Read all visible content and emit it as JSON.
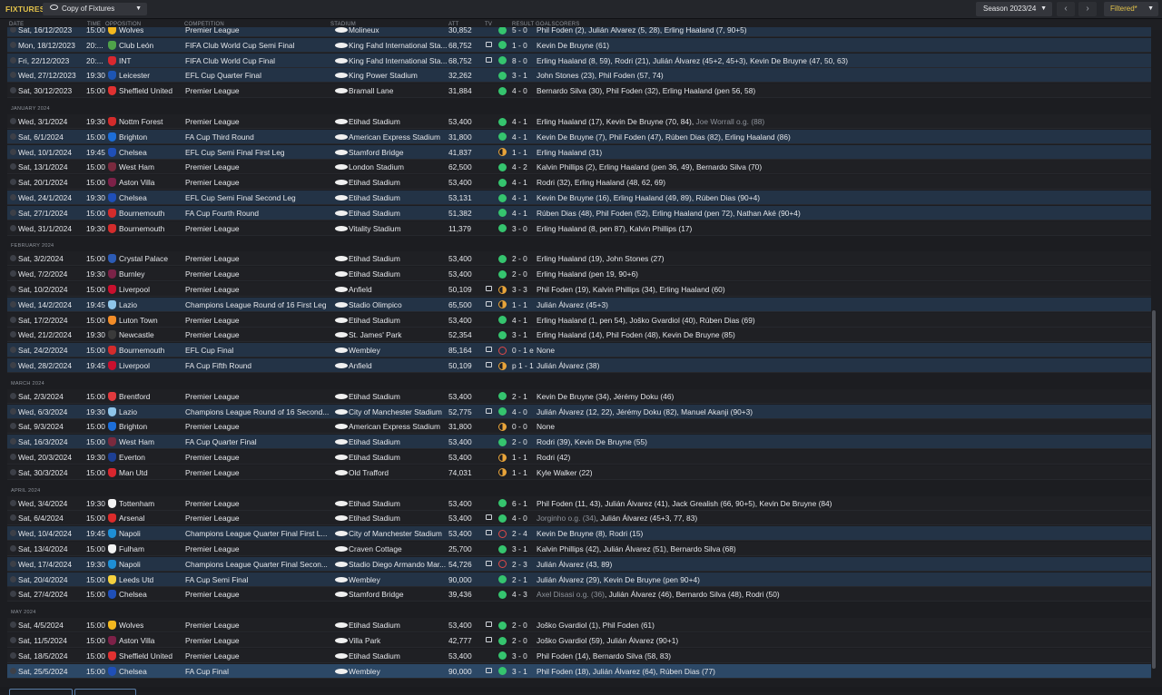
{
  "header": {
    "title": "FIXTURES",
    "view_label": "Copy of Fixtures",
    "season_label": "Season 2023/24",
    "filter_label": "Filtered*"
  },
  "columns": {
    "date": "DATE",
    "time": "TIME",
    "opposition": "OPPOSITION",
    "competition": "COMPETITION",
    "stadium": "STADIUM",
    "att": "ATT",
    "tv": "TV",
    "result": "RESULT",
    "goalscorers": "GOALSCORERS"
  },
  "colors": {
    "win": "#35c46e",
    "draw": "#e8a43a",
    "loss": "#e04848",
    "accent": "#e2c24a"
  },
  "items": [
    {
      "t": "m",
      "date": "Sat, 16/12/2023",
      "time": "15:00",
      "opp": "Wolves",
      "comp": "Premier League",
      "stad": "Molineux",
      "att": "30,852",
      "tv": false,
      "st": "win",
      "res": "5 - 0",
      "goals": "Phil Foden (2), Julián Álvarez (5, 28), Erling Haaland (7, 90+5)",
      "og": "",
      "c": "#f3b81f",
      "bg": "alt"
    },
    {
      "t": "m",
      "date": "Mon, 18/12/2023",
      "time": "20:...",
      "opp": "Club León",
      "comp": "FIFA Club World Cup Semi Final",
      "stad": "King Fahd International Sta...",
      "att": "68,752",
      "tv": true,
      "st": "win",
      "res": "1 - 0",
      "goals": "Kevin De Bruyne (61)",
      "og": "",
      "c": "#4fa34a",
      "bg": "alt"
    },
    {
      "t": "m",
      "date": "Fri, 22/12/2023",
      "time": "20:...",
      "opp": "INT",
      "comp": "FIFA Club World Cup Final",
      "stad": "King Fahd International Sta...",
      "att": "68,752",
      "tv": true,
      "st": "win",
      "res": "8 - 0",
      "goals": "Erling Haaland (8, 59), Rodri (21), Julián Álvarez (45+2, 45+3), Kevin De Bruyne (47, 50, 63)",
      "og": "",
      "c": "#d9282f",
      "bg": "alt"
    },
    {
      "t": "m",
      "date": "Wed, 27/12/2023",
      "time": "19:30",
      "opp": "Leicester",
      "comp": "EFL Cup Quarter Final",
      "stad": "King Power Stadium",
      "att": "32,262",
      "tv": false,
      "st": "win",
      "res": "3 - 1",
      "goals": "John Stones (23), Phil Foden (57, 74)",
      "og": "",
      "c": "#1d55b3",
      "bg": "alt"
    },
    {
      "t": "m",
      "date": "Sat, 30/12/2023",
      "time": "15:00",
      "opp": "Sheffield United",
      "comp": "Premier League",
      "stad": "Bramall Lane",
      "att": "31,884",
      "tv": false,
      "st": "win",
      "res": "4 - 0",
      "goals": "Bernardo Silva (30), Phil Foden (32), Erling Haaland (pen 56, 58)",
      "og": "",
      "c": "#e03131",
      "bg": "plain"
    },
    {
      "t": "h",
      "label": "JANUARY 2024"
    },
    {
      "t": "m",
      "date": "Wed, 3/1/2024",
      "time": "19:30",
      "opp": "Nottm Forest",
      "comp": "Premier League",
      "stad": "Etihad Stadium",
      "att": "53,400",
      "tv": false,
      "st": "win",
      "res": "4 - 1",
      "goals": "Erling Haaland (17), Kevin De Bruyne (70, 84), ",
      "og": "Joe Worrall o.g. (88)",
      "c": "#d22b2b",
      "bg": "plain"
    },
    {
      "t": "m",
      "date": "Sat, 6/1/2024",
      "time": "15:00",
      "opp": "Brighton",
      "comp": "FA Cup Third Round",
      "stad": "American Express Stadium",
      "att": "31,800",
      "tv": false,
      "st": "win",
      "res": "4 - 1",
      "goals": "Kevin De Bruyne (7), Phil Foden (47), Rúben Dias (82), Erling Haaland (86)",
      "og": "",
      "c": "#1d6ed8",
      "bg": "alt"
    },
    {
      "t": "m",
      "date": "Wed, 10/1/2024",
      "time": "19:45",
      "opp": "Chelsea",
      "comp": "EFL Cup Semi Final First Leg",
      "stad": "Stamford Bridge",
      "att": "41,837",
      "tv": false,
      "st": "draw",
      "res": "1 - 1",
      "goals": "Erling Haaland (31)",
      "og": "",
      "c": "#1f4fb8",
      "bg": "alt"
    },
    {
      "t": "m",
      "date": "Sat, 13/1/2024",
      "time": "15:00",
      "opp": "West Ham",
      "comp": "Premier League",
      "stad": "London Stadium",
      "att": "62,500",
      "tv": false,
      "st": "win",
      "res": "4 - 2",
      "goals": "Kalvin Phillips (2), Erling Haaland (pen 36, 49), Bernardo Silva (70)",
      "og": "",
      "c": "#7a2a3e",
      "bg": "plain"
    },
    {
      "t": "m",
      "date": "Sat, 20/1/2024",
      "time": "15:00",
      "opp": "Aston Villa",
      "comp": "Premier League",
      "stad": "Etihad Stadium",
      "att": "53,400",
      "tv": false,
      "st": "win",
      "res": "4 - 1",
      "goals": "Rodri (32), Erling Haaland (48, 62, 69)",
      "og": "",
      "c": "#7d2148",
      "bg": "plain"
    },
    {
      "t": "m",
      "date": "Wed, 24/1/2024",
      "time": "19:30",
      "opp": "Chelsea",
      "comp": "EFL Cup Semi Final Second Leg",
      "stad": "Etihad Stadium",
      "att": "53,131",
      "tv": false,
      "st": "win",
      "res": "4 - 1",
      "goals": "Kevin De Bruyne (16), Erling Haaland (49, 89), Rúben Dias (90+4)",
      "og": "",
      "c": "#1f4fb8",
      "bg": "alt"
    },
    {
      "t": "m",
      "date": "Sat, 27/1/2024",
      "time": "15:00",
      "opp": "Bournemouth",
      "comp": "FA Cup Fourth Round",
      "stad": "Etihad Stadium",
      "att": "51,382",
      "tv": false,
      "st": "win",
      "res": "4 - 1",
      "goals": "Rúben Dias (48), Phil Foden (52), Erling Haaland (pen 72), Nathan Aké (90+4)",
      "og": "",
      "c": "#d32c2c",
      "bg": "alt"
    },
    {
      "t": "m",
      "date": "Wed, 31/1/2024",
      "time": "19:30",
      "opp": "Bournemouth",
      "comp": "Premier League",
      "stad": "Vitality Stadium",
      "att": "11,379",
      "tv": false,
      "st": "win",
      "res": "3 - 0",
      "goals": "Erling Haaland (8, pen 87), Kalvin Phillips (17)",
      "og": "",
      "c": "#d32c2c",
      "bg": "plain"
    },
    {
      "t": "h",
      "label": "FEBRUARY 2024"
    },
    {
      "t": "m",
      "date": "Sat, 3/2/2024",
      "time": "15:00",
      "opp": "Crystal Palace",
      "comp": "Premier League",
      "stad": "Etihad Stadium",
      "att": "53,400",
      "tv": false,
      "st": "win",
      "res": "2 - 0",
      "goals": "Erling Haaland (19), John Stones (27)",
      "og": "",
      "c": "#2c5bb5",
      "bg": "plain"
    },
    {
      "t": "m",
      "date": "Wed, 7/2/2024",
      "time": "19:30",
      "opp": "Burnley",
      "comp": "Premier League",
      "stad": "Etihad Stadium",
      "att": "53,400",
      "tv": false,
      "st": "win",
      "res": "2 - 0",
      "goals": "Erling Haaland (pen 19, 90+6)",
      "og": "",
      "c": "#7a2347",
      "bg": "plain"
    },
    {
      "t": "m",
      "date": "Sat, 10/2/2024",
      "time": "15:00",
      "opp": "Liverpool",
      "comp": "Premier League",
      "stad": "Anfield",
      "att": "50,109",
      "tv": true,
      "st": "draw",
      "res": "3 - 3",
      "goals": "Phil Foden (19), Kalvin Phillips (34), Erling Haaland (60)",
      "og": "",
      "c": "#c8102e",
      "bg": "plain"
    },
    {
      "t": "m",
      "date": "Wed, 14/2/2024",
      "time": "19:45",
      "opp": "Lazio",
      "comp": "Champions League Round of 16  First Leg",
      "stad": "Stadio Olimpico",
      "att": "65,500",
      "tv": true,
      "st": "draw",
      "res": "1 - 1",
      "goals": "Julián Álvarez (45+3)",
      "og": "",
      "c": "#8ec5ea",
      "bg": "alt"
    },
    {
      "t": "m",
      "date": "Sat, 17/2/2024",
      "time": "15:00",
      "opp": "Luton Town",
      "comp": "Premier League",
      "stad": "Etihad Stadium",
      "att": "53,400",
      "tv": false,
      "st": "win",
      "res": "4 - 1",
      "goals": "Erling Haaland (1, pen 54), Joško Gvardiol (40), Rúben Dias (69)",
      "og": "",
      "c": "#f28c28",
      "bg": "plain"
    },
    {
      "t": "m",
      "date": "Wed, 21/2/2024",
      "time": "19:30",
      "opp": "Newcastle",
      "comp": "Premier League",
      "stad": "St. James' Park",
      "att": "52,354",
      "tv": false,
      "st": "win",
      "res": "3 - 1",
      "goals": "Erling Haaland (14), Phil Foden (48), Kevin De Bruyne (85)",
      "og": "",
      "c": "#3a3a3a",
      "bg": "plain"
    },
    {
      "t": "m",
      "date": "Sat, 24/2/2024",
      "time": "15:00",
      "opp": "Bournemouth",
      "comp": "EFL Cup Final",
      "stad": "Wembley",
      "att": "85,164",
      "tv": true,
      "st": "loss",
      "res": "0 - 1 e",
      "goals": "None",
      "og": "",
      "c": "#d32c2c",
      "bg": "alt"
    },
    {
      "t": "m",
      "date": "Wed, 28/2/2024",
      "time": "19:45",
      "opp": "Liverpool",
      "comp": "FA Cup Fifth Round",
      "stad": "Anfield",
      "att": "50,109",
      "tv": true,
      "st": "draw",
      "res": "p 1 - 1",
      "goals": "Julián Álvarez (38)",
      "og": "",
      "c": "#c8102e",
      "bg": "alt"
    },
    {
      "t": "h",
      "label": "MARCH 2024"
    },
    {
      "t": "m",
      "date": "Sat, 2/3/2024",
      "time": "15:00",
      "opp": "Brentford",
      "comp": "Premier League",
      "stad": "Etihad Stadium",
      "att": "53,400",
      "tv": false,
      "st": "win",
      "res": "2 - 1",
      "goals": "Kevin De Bruyne (34), Jérémy Doku (46)",
      "og": "",
      "c": "#e03a3e",
      "bg": "plain"
    },
    {
      "t": "m",
      "date": "Wed, 6/3/2024",
      "time": "19:30",
      "opp": "Lazio",
      "comp": "Champions League Round of 16  Second...",
      "stad": "City of Manchester Stadium",
      "att": "52,775",
      "tv": true,
      "st": "win",
      "res": "4 - 0",
      "goals": "Julián Álvarez (12, 22), Jérémy Doku (82), Manuel Akanji (90+3)",
      "og": "",
      "c": "#8ec5ea",
      "bg": "alt"
    },
    {
      "t": "m",
      "date": "Sat, 9/3/2024",
      "time": "15:00",
      "opp": "Brighton",
      "comp": "Premier League",
      "stad": "American Express Stadium",
      "att": "31,800",
      "tv": false,
      "st": "draw",
      "res": "0 - 0",
      "goals": "None",
      "og": "",
      "c": "#1d6ed8",
      "bg": "plain"
    },
    {
      "t": "m",
      "date": "Sat, 16/3/2024",
      "time": "15:00",
      "opp": "West Ham",
      "comp": "FA Cup Quarter Final",
      "stad": "Etihad Stadium",
      "att": "53,400",
      "tv": false,
      "st": "win",
      "res": "2 - 0",
      "goals": "Rodri (39), Kevin De Bruyne (55)",
      "og": "",
      "c": "#7a2a3e",
      "bg": "alt"
    },
    {
      "t": "m",
      "date": "Wed, 20/3/2024",
      "time": "19:30",
      "opp": "Everton",
      "comp": "Premier League",
      "stad": "Etihad Stadium",
      "att": "53,400",
      "tv": false,
      "st": "draw",
      "res": "1 - 1",
      "goals": "Rodri (42)",
      "og": "",
      "c": "#1d3f94",
      "bg": "plain"
    },
    {
      "t": "m",
      "date": "Sat, 30/3/2024",
      "time": "15:00",
      "opp": "Man Utd",
      "comp": "Premier League",
      "stad": "Old Trafford",
      "att": "74,031",
      "tv": false,
      "st": "draw",
      "res": "1 - 1",
      "goals": "Kyle Walker (22)",
      "og": "",
      "c": "#d8262e",
      "bg": "plain"
    },
    {
      "t": "h",
      "label": "APRIL 2024"
    },
    {
      "t": "m",
      "date": "Wed, 3/4/2024",
      "time": "19:30",
      "opp": "Tottenham",
      "comp": "Premier League",
      "stad": "Etihad Stadium",
      "att": "53,400",
      "tv": false,
      "st": "win",
      "res": "6 - 1",
      "goals": "Phil Foden (11, 43), Julián Álvarez (41), Jack Grealish (66, 90+5), Kevin De Bruyne (84)",
      "og": "",
      "c": "#f2f2f2",
      "bg": "plain"
    },
    {
      "t": "m",
      "date": "Sat, 6/4/2024",
      "time": "15:00",
      "opp": "Arsenal",
      "comp": "Premier League",
      "stad": "Etihad Stadium",
      "att": "53,400",
      "tv": true,
      "st": "win",
      "res": "4 - 0",
      "goals": "",
      "og": "Jorginho o.g. (34)",
      "goals2": ", Julián Álvarez (45+3, 77, 83)",
      "c": "#db2b2b",
      "bg": "plain"
    },
    {
      "t": "m",
      "date": "Wed, 10/4/2024",
      "time": "19:45",
      "opp": "Napoli",
      "comp": "Champions League Quarter Final First L...",
      "stad": "City of Manchester Stadium",
      "att": "53,400",
      "tv": true,
      "st": "loss",
      "res": "2 - 4",
      "goals": "Kevin De Bruyne (8), Rodri (15)",
      "og": "",
      "c": "#1e8fd6",
      "bg": "alt"
    },
    {
      "t": "m",
      "date": "Sat, 13/4/2024",
      "time": "15:00",
      "opp": "Fulham",
      "comp": "Premier League",
      "stad": "Craven Cottage",
      "att": "25,700",
      "tv": false,
      "st": "win",
      "res": "3 - 1",
      "goals": "Kalvin Phillips (42), Julián Álvarez (51), Bernardo Silva (68)",
      "og": "",
      "c": "#f2f2f2",
      "bg": "plain"
    },
    {
      "t": "m",
      "date": "Wed, 17/4/2024",
      "time": "19:30",
      "opp": "Napoli",
      "comp": "Champions League Quarter Final Secon...",
      "stad": "Stadio Diego Armando Mar...",
      "att": "54,726",
      "tv": true,
      "st": "loss",
      "res": "2 - 3",
      "goals": "Julián Álvarez (43, 89)",
      "og": "",
      "c": "#1e8fd6",
      "bg": "alt"
    },
    {
      "t": "m",
      "date": "Sat, 20/4/2024",
      "time": "15:00",
      "opp": "Leeds Utd",
      "comp": "FA Cup Semi Final",
      "stad": "Wembley",
      "att": "90,000",
      "tv": false,
      "st": "win",
      "res": "2 - 1",
      "goals": "Julián Álvarez (29), Kevin De Bruyne (pen 90+4)",
      "og": "",
      "c": "#f4d03f",
      "bg": "alt"
    },
    {
      "t": "m",
      "date": "Sat, 27/4/2024",
      "time": "15:00",
      "opp": "Chelsea",
      "comp": "Premier League",
      "stad": "Stamford Bridge",
      "att": "39,436",
      "tv": false,
      "st": "win",
      "res": "4 - 3",
      "goals": "",
      "og": "Axel Disasi o.g. (36)",
      "goals2": ", Julián Álvarez (46), Bernardo Silva (48), Rodri (50)",
      "c": "#1f4fb8",
      "bg": "plain"
    },
    {
      "t": "h",
      "label": "MAY 2024"
    },
    {
      "t": "m",
      "date": "Sat, 4/5/2024",
      "time": "15:00",
      "opp": "Wolves",
      "comp": "Premier League",
      "stad": "Etihad Stadium",
      "att": "53,400",
      "tv": true,
      "st": "win",
      "res": "2 - 0",
      "goals": "Joško Gvardiol (1), Phil Foden (61)",
      "og": "",
      "c": "#f3b81f",
      "bg": "plain"
    },
    {
      "t": "m",
      "date": "Sat, 11/5/2024",
      "time": "15:00",
      "opp": "Aston Villa",
      "comp": "Premier League",
      "stad": "Villa Park",
      "att": "42,777",
      "tv": true,
      "st": "win",
      "res": "2 - 0",
      "goals": "Joško Gvardiol (59), Julián Álvarez (90+1)",
      "og": "",
      "c": "#7d2148",
      "bg": "plain"
    },
    {
      "t": "m",
      "date": "Sat, 18/5/2024",
      "time": "15:00",
      "opp": "Sheffield United",
      "comp": "Premier League",
      "stad": "Etihad Stadium",
      "att": "53,400",
      "tv": false,
      "st": "win",
      "res": "3 - 0",
      "goals": "Phil Foden (14), Bernardo Silva (58, 83)",
      "og": "",
      "c": "#e03131",
      "bg": "plain"
    },
    {
      "t": "m",
      "date": "Sat, 25/5/2024",
      "time": "15:00",
      "opp": "Chelsea",
      "comp": "FA Cup Final",
      "stad": "Wembley",
      "att": "90,000",
      "tv": true,
      "st": "win",
      "res": "3 - 1",
      "goals": "Phil Foden (18), Julián Álvarez (64), Rúben Dias (77)",
      "og": "",
      "c": "#1f4fb8",
      "bg": "sel"
    }
  ]
}
